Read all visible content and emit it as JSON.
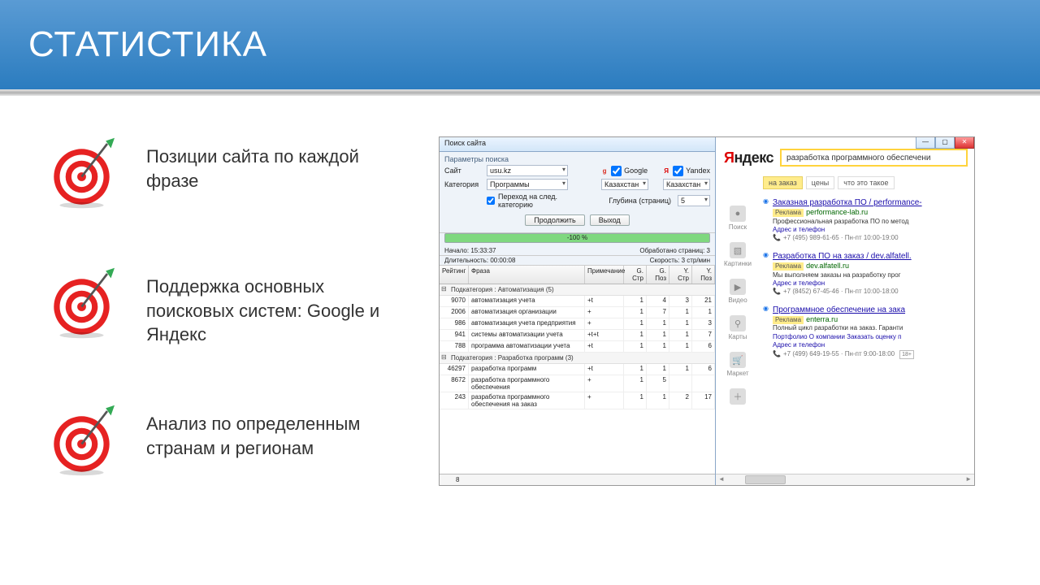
{
  "slide": {
    "title": "СТАТИСТИКА",
    "bullets": [
      "Позиции сайта по каждой фразе",
      "Поддержка основных поисковых систем: Google и Яндекс",
      "Анализ по определенным странам и регионам"
    ]
  },
  "app": {
    "window_title": "Поиск сайта",
    "params_title": "Параметры поиска",
    "labels": {
      "site": "Сайт",
      "category": "Категория",
      "depth": "Глубина (страниц)"
    },
    "site_value": "usu.kz",
    "category_value": "Программы",
    "next_cat_check": "Переход на след. категорию",
    "depth_value": "5",
    "engines": {
      "google": "Google",
      "google_region": "Казахстан",
      "yandex": "Yandex",
      "yandex_region": "Казахстан"
    },
    "buttons": {
      "continue": "Продолжить",
      "exit": "Выход"
    },
    "progress": "-100 %",
    "status": {
      "start_label": "Начало:",
      "start_value": "15:33:37",
      "duration_label": "Длительность:",
      "duration_value": "00:00:08",
      "pages_label": "Обработано страниц:",
      "pages_value": "3",
      "speed_label": "Скорость:",
      "speed_value": "3 стр/мин"
    },
    "grid": {
      "headers": {
        "rating": "Рейтинг",
        "phrase": "Фраза",
        "note": "Примечание",
        "gpage": "G. Стр",
        "gpos": "G. Поз",
        "ypage": "Y. Стр",
        "ypos": "Y. Поз"
      },
      "group1": "Подкатегория : Автоматизация (5)",
      "rows1": [
        {
          "rating": "9070",
          "phrase": "автоматизация учета",
          "note": "+t",
          "gs": "1",
          "gp": "4",
          "ys": "3",
          "yp": "21"
        },
        {
          "rating": "2006",
          "phrase": "автоматизация организации",
          "note": "+",
          "gs": "1",
          "gp": "7",
          "ys": "1",
          "yp": "1"
        },
        {
          "rating": "986",
          "phrase": "автоматизация учета предприятия",
          "note": "+",
          "gs": "1",
          "gp": "1",
          "ys": "1",
          "yp": "3"
        },
        {
          "rating": "941",
          "phrase": "системы автоматизации учета",
          "note": "+t+t",
          "gs": "1",
          "gp": "1",
          "ys": "1",
          "yp": "7"
        },
        {
          "rating": "788",
          "phrase": "программа автоматизации учета",
          "note": "+t",
          "gs": "1",
          "gp": "1",
          "ys": "1",
          "yp": "6"
        }
      ],
      "group2": "Подкатегория : Разработка программ (3)",
      "rows2": [
        {
          "rating": "46297",
          "phrase": "разработка программ",
          "note": "+t",
          "gs": "1",
          "gp": "1",
          "ys": "1",
          "yp": "6"
        },
        {
          "rating": "8672",
          "phrase": "разработка программного обеспечения",
          "note": "+",
          "gs": "1",
          "gp": "5",
          "ys": "",
          "yp": ""
        },
        {
          "rating": "243",
          "phrase": "разработка программного обеспечения на заказ",
          "note": "+",
          "gs": "1",
          "gp": "1",
          "ys": "2",
          "yp": "17"
        }
      ],
      "footer": "8"
    }
  },
  "serp": {
    "logo": "Яндекс",
    "query": "разработка программного обеспечени",
    "tags": [
      "на заказ",
      "цены",
      "что это такое"
    ],
    "nav": [
      {
        "icon": "●",
        "label": "Поиск"
      },
      {
        "icon": "▧",
        "label": "Картинки"
      },
      {
        "icon": "▶",
        "label": "Видео"
      },
      {
        "icon": "⚲",
        "label": "Карты"
      },
      {
        "icon": "🛒",
        "label": "Маркет"
      },
      {
        "icon": "＋",
        "label": ""
      }
    ],
    "results": [
      {
        "title": "Заказная разработка ПО / performance-",
        "ad": "Реклама",
        "domain": "performance-lab.ru",
        "snippet": "Профессиональная разработка ПО по метод",
        "links": "Адрес и телефон",
        "phone": "+7 (495) 989-61-65 · Пн-пт 10:00-19:00"
      },
      {
        "title": "Разработка ПО на заказ / dev.alfatell.",
        "ad": "Реклама",
        "domain": "dev.alfatell.ru",
        "snippet": "Мы выполняем заказы на разработку прог",
        "links": "Адрес и телефон",
        "phone": "+7 (8452) 67-45-46 · Пн-пт 10:00-18:00"
      },
      {
        "title": "Программное обеспечение на зака",
        "ad": "Реклама",
        "domain": "enterra.ru",
        "snippet": "Полный цикл разработки на заказ. Гаранти",
        "links": "Портфолио   О компании   Заказать оценку п",
        "links2": "Адрес и телефон",
        "phone": "+7 (499) 649-19-55 · Пн-пт 9:00-18:00",
        "age": "18+"
      }
    ]
  }
}
